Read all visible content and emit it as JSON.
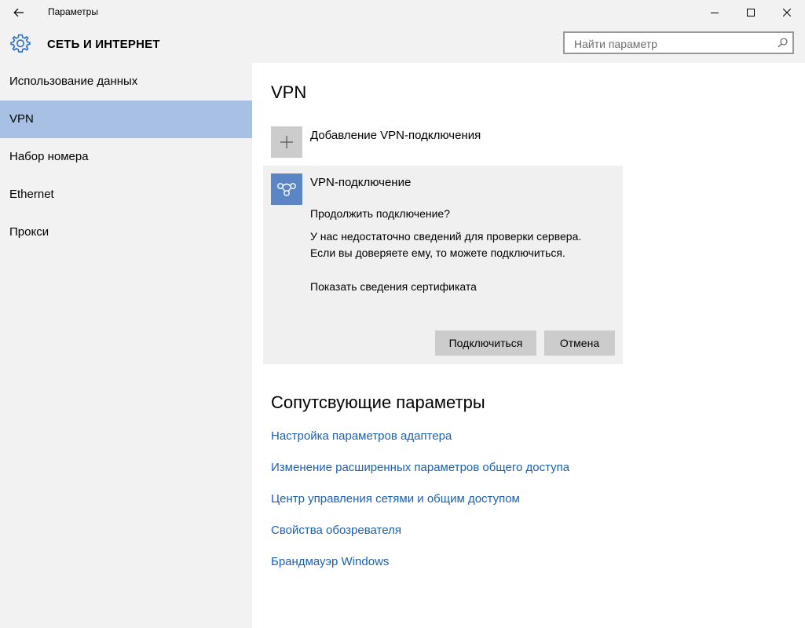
{
  "window": {
    "title": "Параметры"
  },
  "header": {
    "section_title": "СЕТЬ И ИНТЕРНЕТ",
    "search_placeholder": "Найти параметр"
  },
  "sidebar": {
    "items": [
      {
        "label": "Использование данных"
      },
      {
        "label": "VPN",
        "selected": true
      },
      {
        "label": "Набор номера"
      },
      {
        "label": "Ethernet"
      },
      {
        "label": "Прокси"
      }
    ]
  },
  "main": {
    "title": "VPN",
    "add_vpn_label": "Добавление VPN-подключения",
    "vpn_card": {
      "name": "VPN-подключение",
      "question": "Продолжить подключение?",
      "message_line1": "У нас недостаточно сведений для проверки сервера.",
      "message_line2": "Если вы доверяете ему, то можете подключиться.",
      "cert_link": "Показать сведения сертификата",
      "connect_label": "Подключиться",
      "cancel_label": "Отмена"
    },
    "related": {
      "title": "Сопутсвующие параметры",
      "links": [
        {
          "label": "Настройка параметров адаптера"
        },
        {
          "label": "Изменение расширенных параметров общего доступа"
        },
        {
          "label": "Центр управления сетями и общим доступом"
        },
        {
          "label": "Свойства обозревателя"
        },
        {
          "label": "Брандмауэр Windows"
        }
      ]
    }
  },
  "colors": {
    "chrome_bg": "#f2f2f2",
    "selected_bg": "#a7c0e4",
    "vpn_tile": "#5b85c4",
    "link": "#1a5fb4",
    "button_bg": "#cccccc"
  },
  "icons": {
    "back": "arrow-left-icon",
    "minimize": "minimize-icon",
    "maximize": "maximize-icon",
    "close": "close-icon",
    "settings": "gear-icon",
    "search": "search-icon",
    "add": "plus-icon",
    "vpn": "vpn-icon"
  }
}
